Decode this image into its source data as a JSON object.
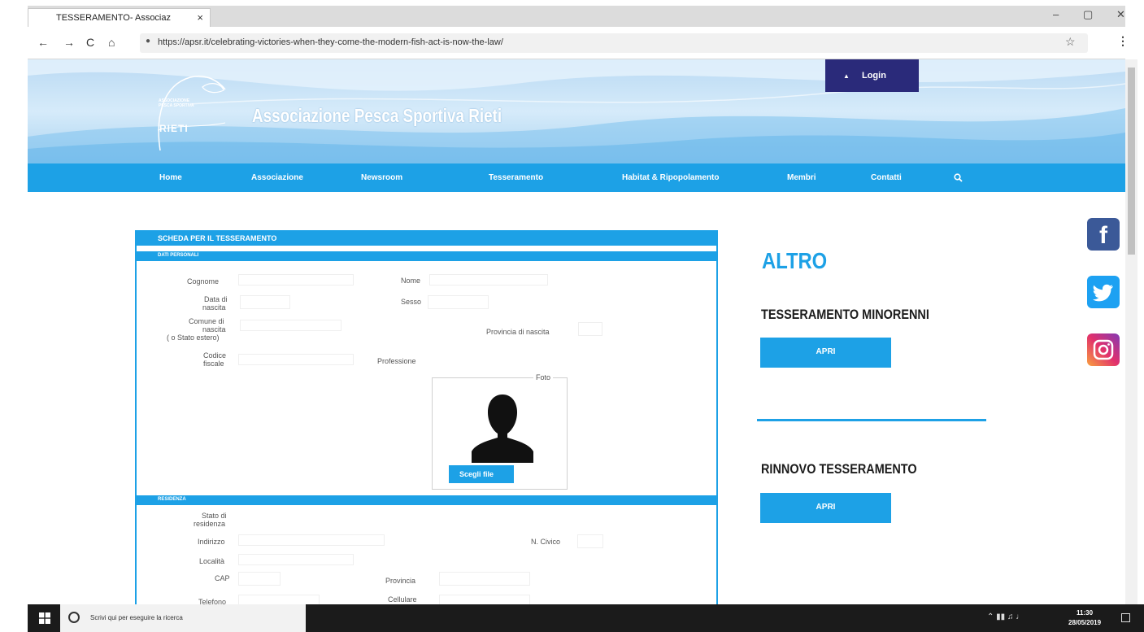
{
  "browser": {
    "tab_title": "TESSERAMENTO- Associaz",
    "tab_close": "×",
    "url": "https://apsr.it/celebrating-victories-when-they-come-the-modern-fish-act-is-now-the-law/",
    "controls": {
      "minimize": "–",
      "restore": "▢",
      "close": "✕"
    },
    "nav": {
      "back": "←",
      "forward": "→",
      "reload": "C",
      "home": "⌂"
    }
  },
  "site": {
    "logo_small_text": "ASSOCIAZIONE PESCA SPORTIVA",
    "logo_city": "RIETI",
    "title": "Associazione Pesca Sportiva Rieti",
    "login_label": "Login"
  },
  "nav": {
    "items": [
      "Home",
      "Associazione",
      "Newsroom",
      "Tesseramento",
      "Habitat & Ripopolamento",
      "Membri",
      "Contatti"
    ]
  },
  "form": {
    "title": "SCHEDA PER IL TESSERAMENTO",
    "section_personal": "DATI PERSONALI",
    "labels": {
      "cognome": "Cognome",
      "nome": "Nome",
      "data_nascita_1": "Data di",
      "data_nascita_2": "nascita",
      "sesso": "Sesso",
      "comune_1": "Comune di",
      "comune_2": "nascita",
      "comune_3": "( o Stato estero)",
      "provincia_nascita": "Provincia di nascita",
      "codice_1": "Codice",
      "codice_2": "fiscale",
      "professione": "Professione",
      "foto": "Foto"
    },
    "file_button": "Scegli file",
    "section_residence": "RESIDENZA",
    "residence_labels": {
      "stato_1": "Stato di",
      "stato_2": "residenza",
      "indirizzo": "Indirizzo",
      "civico": "N. Civico",
      "localita": "Località",
      "cap": "CAP",
      "provincia": "Provincia",
      "telefono": "Telefono",
      "cellulare": "Cellulare"
    }
  },
  "sidebar": {
    "heading": "ALTRO",
    "block1_title": "TESSERAMENTO MINORENNI",
    "block1_button": "APRI",
    "block2_title": "RINNOVO TESSERAMENTO",
    "block2_button": "APRI"
  },
  "social": {
    "facebook": "f",
    "twitter": "t",
    "instagram": "ig"
  },
  "taskbar": {
    "search_placeholder": "Scrivi qui per eseguire la ricerca",
    "time": "11:30",
    "date": "28/05/2019"
  },
  "colors": {
    "accent": "#1da1e6",
    "login_bg": "#2a2a7a",
    "taskbar": "#1b1b1b"
  }
}
